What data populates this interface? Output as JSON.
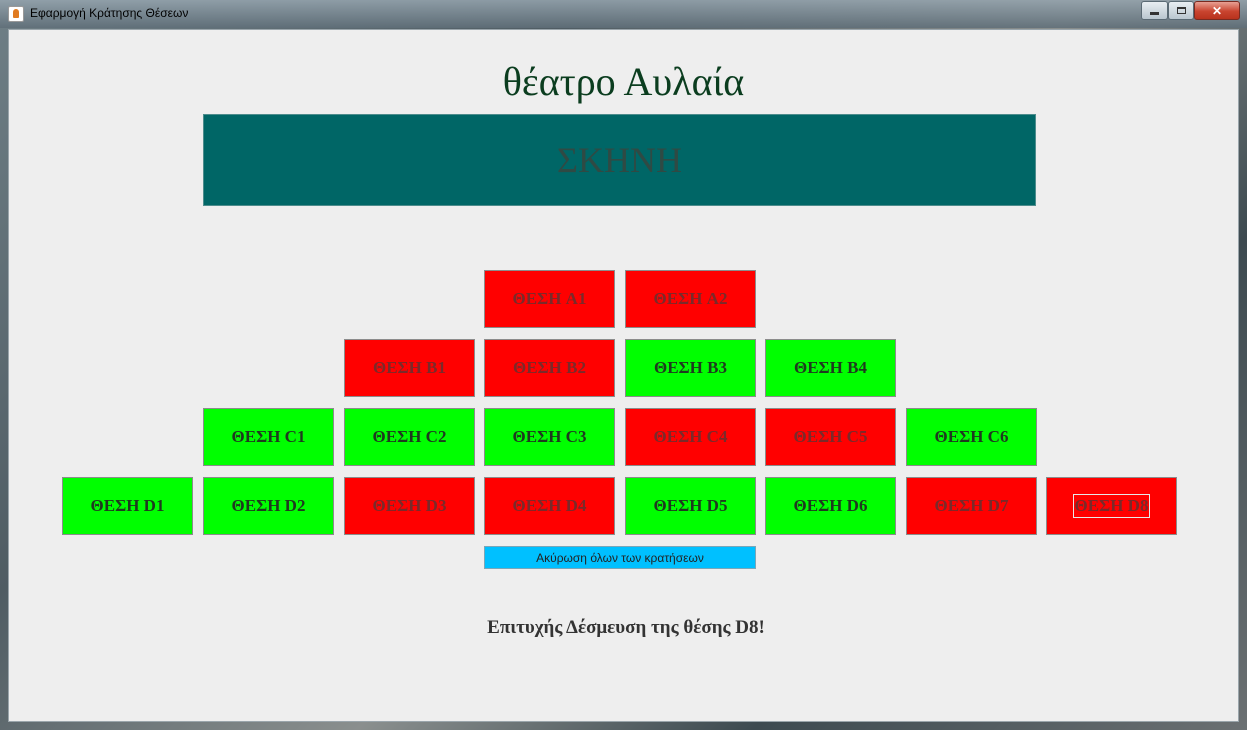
{
  "window": {
    "title": "Εφαρμογή Κράτησης Θέσεων",
    "minimize_glyph": "",
    "close_glyph": "✕"
  },
  "theatre": {
    "title": "θέατρο Αυλαία",
    "stage_label": "ΣΚΗΝΗ"
  },
  "colors": {
    "booked": "#ff0000",
    "free": "#00ff00",
    "stage": "#006666",
    "cancel_button": "#00c0ff"
  },
  "seats": {
    "A1": {
      "label": "ΘΕΣΗ A1",
      "status": "booked"
    },
    "A2": {
      "label": "ΘΕΣΗ A2",
      "status": "booked"
    },
    "B1": {
      "label": "ΘΕΣΗ B1",
      "status": "booked"
    },
    "B2": {
      "label": "ΘΕΣΗ B2",
      "status": "booked"
    },
    "B3": {
      "label": "ΘΕΣΗ B3",
      "status": "free"
    },
    "B4": {
      "label": "ΘΕΣΗ B4",
      "status": "free"
    },
    "C1": {
      "label": "ΘΕΣΗ C1",
      "status": "free"
    },
    "C2": {
      "label": "ΘΕΣΗ C2",
      "status": "free"
    },
    "C3": {
      "label": "ΘΕΣΗ C3",
      "status": "free"
    },
    "C4": {
      "label": "ΘΕΣΗ C4",
      "status": "booked"
    },
    "C5": {
      "label": "ΘΕΣΗ C5",
      "status": "booked"
    },
    "C6": {
      "label": "ΘΕΣΗ C6",
      "status": "free"
    },
    "D1": {
      "label": "ΘΕΣΗ D1",
      "status": "free"
    },
    "D2": {
      "label": "ΘΕΣΗ D2",
      "status": "free"
    },
    "D3": {
      "label": "ΘΕΣΗ D3",
      "status": "booked"
    },
    "D4": {
      "label": "ΘΕΣΗ D4",
      "status": "booked"
    },
    "D5": {
      "label": "ΘΕΣΗ D5",
      "status": "free"
    },
    "D6": {
      "label": "ΘΕΣΗ D6",
      "status": "free"
    },
    "D7": {
      "label": "ΘΕΣΗ D7",
      "status": "booked"
    },
    "D8": {
      "label": "ΘΕΣΗ D8",
      "status": "booked"
    }
  },
  "cancel_all_label": "Ακύρωση όλων των κρατήσεων",
  "status_message": "Επιτυχής Δέσμευση της θέσης D8!"
}
